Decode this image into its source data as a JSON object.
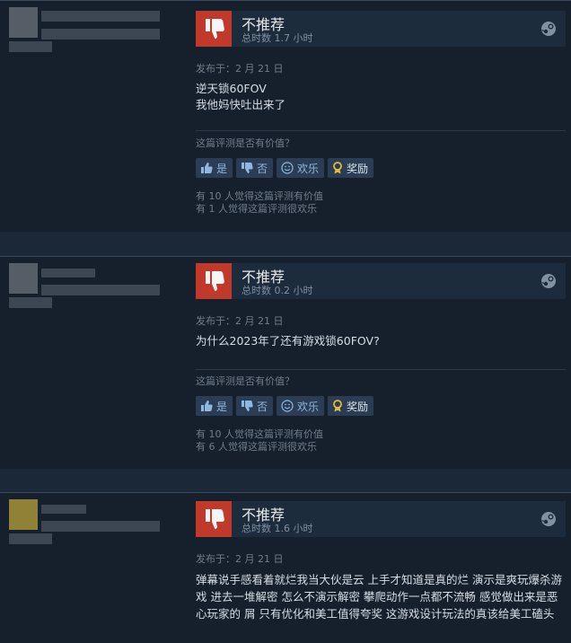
{
  "reviews": [
    {
      "verdict": "不推荐",
      "hours": "总时数 1.7 小时",
      "posted": "发布于：2 月 21 日",
      "content": "逆天锁60FOV\n我他妈快吐出来了",
      "helpful_question": "这篇评测是否有价值？",
      "buttons": {
        "yes": "是",
        "no": "否",
        "funny": "欢乐",
        "award": "奖励"
      },
      "stats": [
        "有 10 人觉得这篇评测有价值",
        "有 1 人觉得这篇评测很欢乐"
      ]
    },
    {
      "verdict": "不推荐",
      "hours": "总时数 0.2 小时",
      "posted": "发布于：2 月 21 日",
      "content": "为什么2023年了还有游戏锁60FOV?",
      "helpful_question": "这篇评测是否有价值？",
      "buttons": {
        "yes": "是",
        "no": "否",
        "funny": "欢乐",
        "award": "奖励"
      },
      "stats": [
        "有 10 人觉得这篇评测有价值",
        "有 6 人觉得这篇评测很欢乐"
      ]
    },
    {
      "verdict": "不推荐",
      "hours": "总时数 1.6 小时",
      "posted": "发布于：2 月 21 日",
      "content": "弹幕说手感看着就烂我当大伙是云 上手才知道是真的烂 演示是爽玩爆杀游戏 进去一堆解密 怎么不演示解密 攀爬动作一点都不流畅 感觉做出来是恶心玩家的 屑 只有优化和美工值得夸奖 这游戏设计玩法的真该给美工磕头"
    }
  ],
  "colors": {
    "thumb_down_bg": "#c0392b",
    "button_bg": "#2a3d55",
    "page_bg": "#1b2838",
    "review_bg": "#16202d"
  },
  "icons": {
    "verdict": "thumb-down-icon",
    "platform": "steam-icon",
    "yes": "thumbs-up-icon",
    "no": "thumbs-down-icon",
    "funny": "smiley-icon",
    "award": "award-ribbon-icon"
  }
}
